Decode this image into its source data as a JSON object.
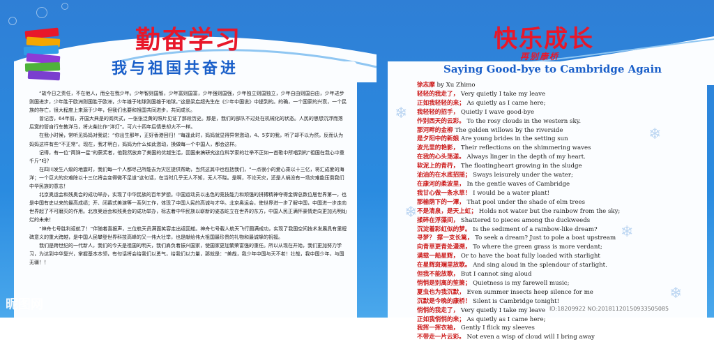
{
  "left": {
    "title": "勤奋学习",
    "subtitle": "我与祖国共奋进",
    "paragraphs": [
      "“故今日之责任，不在他人，而全在我少年。少年智则国智，少年富则国富，少年强则国强，少年独立则国独立，少年自由则国自由，少年进步则国进步，少年胜于欧洲则国胜于欧洲，少年雄于地球则国雄于地球。”这是梁启超先生在《少年中国说》中提到的。的确，一个国家的兴衰，一个民族的存亡，很大程度上来源于少年，但我们也要和祖国共同进步，共同成长。",
      "曾记否，64年前，开国大典是的阅兵式，一张张泛黄的照片见证了那段历史。那是，我们的部队不过处在机械化的状态。人民的思想沉浮而落后寞的管自行车教洋马，将火柴比作“洋灯”。可六十四年后情景却大不一样。",
      "在我小时候，常听见妈妈对我说：“你出生那年，正好香港回归！”每逢此时，妈妈就显得异常激动，4、5岁的我，听了却不以为然，反而认为妈妈这样有些“不正常”。现在，我才明白，妈妈为什么如此激动，换做每一个中国人，都会这样。",
      "记得，有一位“两弹一星”的获奖者，他毅然放弃了美国的优越生活，回国来搞研究这位科学家的壮举不正如一首歌中所唱到的“祖国在我心中重千斤”吗？",
      "在四川发生八级的地震时，我们每一个人都尽己所能去为灾区提供帮助，当然这其中也包括我们，“一点很小的爱心乘以十三亿，将汇成爱的海洋；一个巨大的灾难除以十三亿将会变得微不足道”这句话，在当时几乎无人不知，无人不晓。是啊，不论天灾，还是人祸没有一场灾难能压倒我们中华民族的意志！",
      "北京奥运会和残奥会的成功举办，实现了中华民族的百年梦想。中国运动员以出色的竞技能力和顽强的拼搏精神夺得金牌总数位居世界第一，也是中国有史以来的最高成绩；开、闭幕式美演等一系列工作，体现了中国人民的高诚与才华。北京奥运会，使世界进一步了解中国，中国进一步走向世界起了不可磨灭的作用。北京奥运会和残奥会的成功举办，标志着中华民族以崭新的姿态屹立在世界的东方，中国人民正满怀豪情走向更加光明灿烂的未来！",
      "“神舟七号胜利返航了！”伴随着喜报声，三位航天员满面笑容走出返回舱。神舟七号载人航天飞行圆满成功，实现了我国空间技术发展具有里程碑意义的重大跨越，是中国人民攀登世界科技高峰的又一伟大壮举，也是献给伟大祖国最珍贵的礼物和最诚挚的祝福。",
      "我们是跨世纪的一代新人，我们的今天是祖国的明天，我们肩负着振兴国家，使国家更加繁荣富强的重任。所以从现在开始，我们更加努力学习，为达到中华复兴，掌握基本本领，有句话将会给我们以勇气，给我们以力量，那就是：“美哉，我少年中国与天不老！壮哉，我中国少年，与国无疆！！"
    ]
  },
  "right": {
    "title": "快乐成长",
    "subtitle": "再别康桥",
    "poem_title": "Saying Good-bye to Cambridge Again",
    "author": {
      "cn": "徐志摩",
      "en": "by Xu Zhimo"
    },
    "lines": [
      {
        "cn": "轻轻的我走了，",
        "en": "Very quietly I take my leave"
      },
      {
        "cn": "正如我轻轻的来；",
        "en": "As quietly as I came here;"
      },
      {
        "cn": "我轻轻的招手，",
        "en": "Quietly I wave good-bye"
      },
      {
        "cn": "作别西天的云彩。",
        "en": "To the rosy clouds in the western sky."
      },
      {
        "cn": "那河畔的金柳",
        "en": "The golden willows by the riverside"
      },
      {
        "cn": "是夕阳中的新娘",
        "en": "Are young brides in the setting sun"
      },
      {
        "cn": "波光里的艳影，",
        "en": "Their reflections on the shimmering waves"
      },
      {
        "cn": "在我的心头荡漾。",
        "en": "Always linger in the depth of my heart."
      },
      {
        "cn": "软泥上的青荇，",
        "en": "The floatingheart growing in the sludge"
      },
      {
        "cn": "油油的在水底招摇；",
        "en": "Sways leisurely under the water;"
      },
      {
        "cn": "在康河的柔波里，",
        "en": "In the gentle waves of Cambridge"
      },
      {
        "cn": "我甘心做一条水草！",
        "en": "I would be a water plant!"
      },
      {
        "cn": "那榆荫下的一潭，",
        "en": "That pool under the shade of elm trees"
      },
      {
        "cn": "不是清泉，是天上虹；",
        "en": "Holds not water but the rainbow from the sky;"
      },
      {
        "cn": "揉碎在浮藻间，",
        "en": "Shattered to pieces among the duckweeds"
      },
      {
        "cn": "沉淀着彩虹似的梦。",
        "en": "Is the sediment of a rainbow-like dream?"
      },
      {
        "cn": "寻梦？ 撑一支长篙，",
        "en": "To seek a dream? Just to pole a boat upstream"
      },
      {
        "cn": "向青草更青处漫溯，",
        "en": "To where the green grass is more verdant;"
      },
      {
        "cn": "满载一船星辉，",
        "en": "Or to have the boat fully loaded with starlight"
      },
      {
        "cn": "在星辉斑斓里放歌。",
        "en": "And sing aloud in the splendour of starlight."
      },
      {
        "cn": "但我不能放歌，",
        "en": "But I cannot sing aloud"
      },
      {
        "cn": "悄悄是别离的笙箫；",
        "en": "Quietness is my farewell music;"
      },
      {
        "cn": "夏虫也为我沉默，",
        "en": "Even summer insects heep silence for me"
      },
      {
        "cn": "沉默是今晚的康桥！",
        "en": "Silent is Cambridge tonight!"
      },
      {
        "cn": "悄悄的我走了，",
        "en": "Very quietly I take my leave"
      },
      {
        "cn": "正如我悄悄的来；",
        "en": "As quietly as I came here;"
      },
      {
        "cn": "我挥一挥衣袖，",
        "en": "Gently I flick my sleeves"
      },
      {
        "cn": "不带走一片云彩。",
        "en": "Not even a wisp of cloud will I bring away"
      }
    ]
  },
  "watermark": {
    "left": "昵图网",
    "right": "ID:18209922 NO:20181120150933505085"
  },
  "colors": {
    "title_red": "#e8172a",
    "accent_blue": "#1a5fc9",
    "bg_blue": "#2a8be0"
  }
}
